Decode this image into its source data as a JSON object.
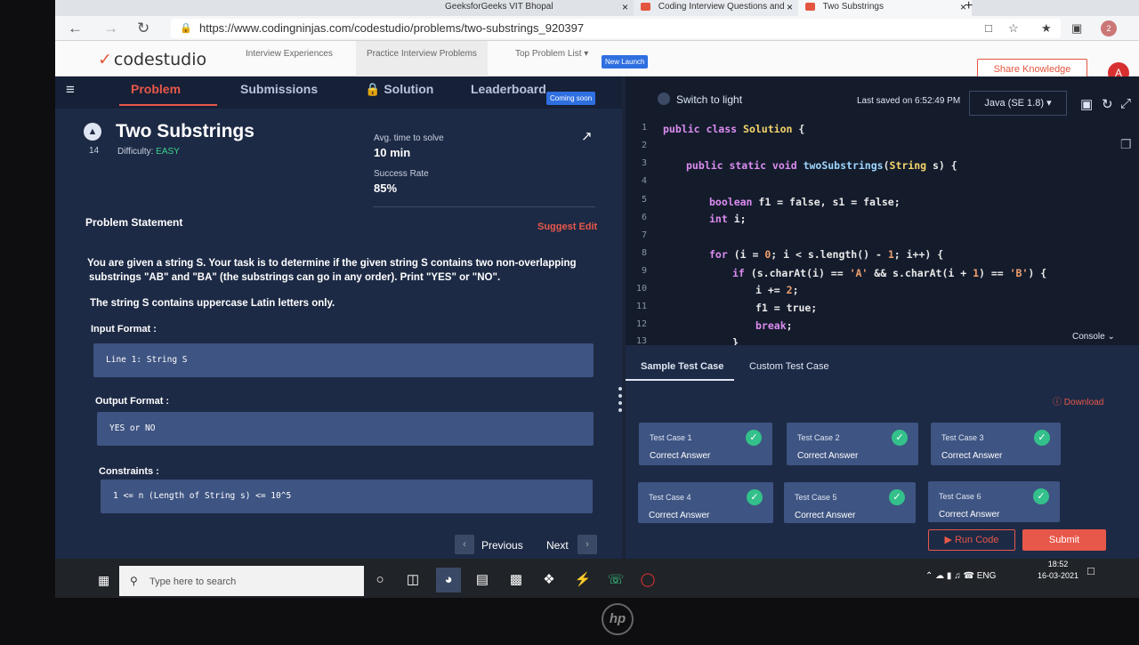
{
  "browser": {
    "tabs": [
      {
        "title": "GeeksforGeeks VIT Bhopal",
        "close": "×"
      },
      {
        "title": "Coding Interview Questions and",
        "close": "×"
      },
      {
        "title": "Two Substrings",
        "close": "×"
      }
    ],
    "new_tab": "+",
    "url": "https://www.codingninjas.com/codestudio/problems/two-substrings_920397",
    "profile_initial": "2"
  },
  "site": {
    "logo": "codestudio",
    "nav": [
      "Interview Experiences",
      "Practice Interview Problems",
      "Top Problem List"
    ],
    "new_launch": "New Launch",
    "share": "Share Knowledge",
    "avatar": "A"
  },
  "left": {
    "tabs": [
      "Problem",
      "Submissions",
      "Solution",
      "Leaderboard"
    ],
    "coming_soon": "Coming soon",
    "title": "Two Substrings",
    "number": "14",
    "difficulty_label": "Difficulty:",
    "difficulty": "EASY",
    "avg_time_label": "Avg. time to solve",
    "avg_time": "10 min",
    "success_label": "Success Rate",
    "success": "85%",
    "statement_header": "Problem Statement",
    "suggest_edit": "Suggest Edit",
    "statement_1": "You are given a string S. Your task is to determine if the given string S contains two non-overlapping",
    "statement_2": "substrings \"AB\" and \"BA\" (the substrings can go in any order). Print \"YES\" or \"NO\".",
    "statement_3": "The string S contains uppercase Latin letters only.",
    "input_header": "Input Format :",
    "input_code": "Line 1: String S",
    "output_header": "Output Format :",
    "output_code": "YES or NO",
    "constraints_header": "Constraints :",
    "constraints_code": "1 <= n (Length of String s) <= 10^5",
    "previous": "Previous",
    "next": "Next"
  },
  "editor": {
    "switch": "Switch to light",
    "saved": "Last saved on 6:52:49 PM",
    "language": "Java (SE 1.8)",
    "console": "Console",
    "line_numbers": [
      "1",
      "2",
      "3",
      "4",
      "5",
      "6",
      "7",
      "8",
      "9",
      "10",
      "11",
      "12",
      "13"
    ],
    "sample_tab": "Sample Test Case",
    "custom_tab": "Custom Test Case",
    "download": "Download",
    "test_cases": [
      {
        "name": "Test Case 1",
        "result": "Correct Answer"
      },
      {
        "name": "Test Case 2",
        "result": "Correct Answer"
      },
      {
        "name": "Test Case 3",
        "result": "Correct Answer"
      },
      {
        "name": "Test Case 4",
        "result": "Correct Answer"
      },
      {
        "name": "Test Case 5",
        "result": "Correct Answer"
      },
      {
        "name": "Test Case 6",
        "result": "Correct Answer"
      }
    ],
    "run": "Run Code",
    "submit": "Submit"
  },
  "taskbar": {
    "search": "Type here to search",
    "lang": "ENG",
    "time": "18:52",
    "date": "16-03-2021"
  },
  "colors": {
    "accent": "#e8584a",
    "panel": "#1d2a45",
    "success": "#33c08a"
  }
}
